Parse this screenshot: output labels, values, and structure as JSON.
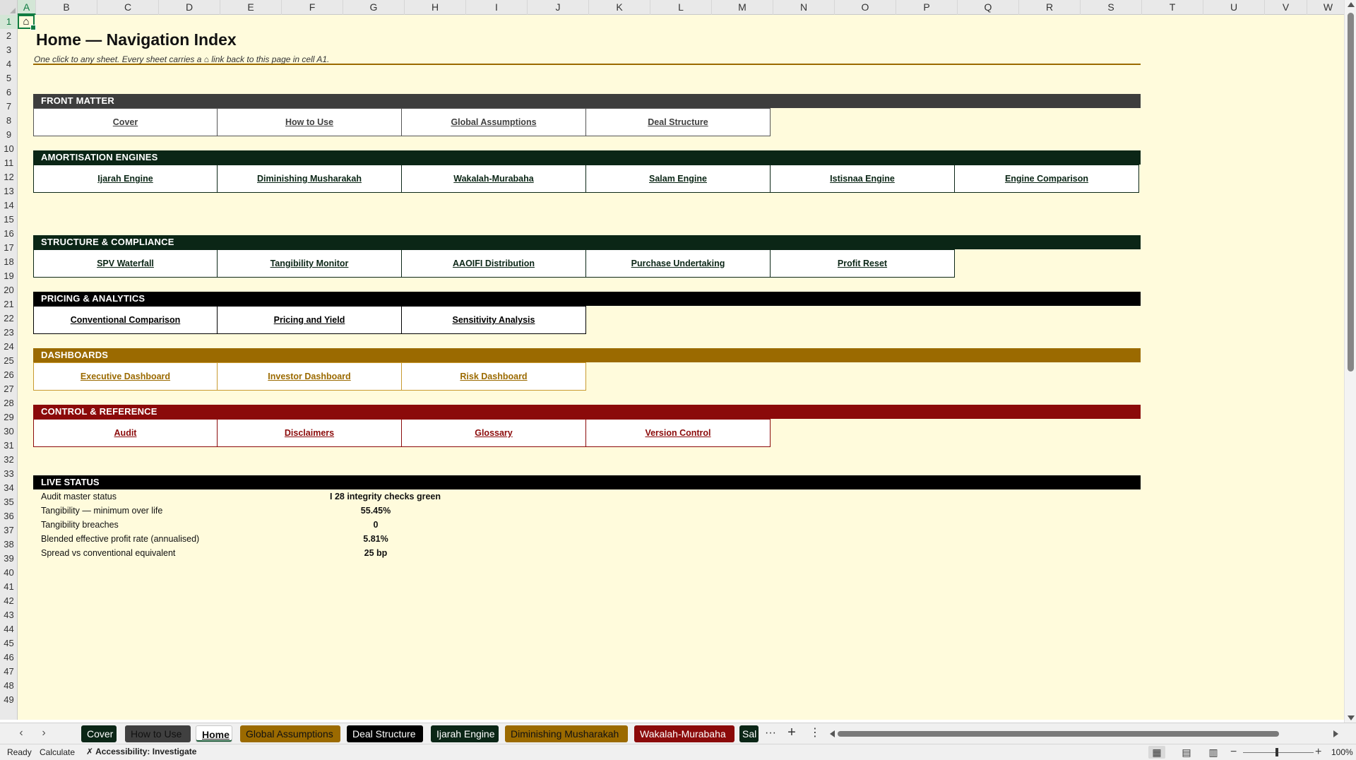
{
  "sheet": {
    "columns": [
      "A",
      "B",
      "C",
      "D",
      "E",
      "F",
      "G",
      "H",
      "I",
      "J",
      "K",
      "L",
      "M",
      "N",
      "O",
      "P",
      "Q",
      "R",
      "S",
      "T",
      "U",
      "V",
      "W"
    ],
    "rows": [
      "1",
      "2",
      "3",
      "4",
      "5",
      "6",
      "7",
      "8",
      "9",
      "10",
      "11",
      "12",
      "13",
      "14",
      "15",
      "16",
      "17",
      "18",
      "19",
      "20",
      "21",
      "22",
      "23",
      "24",
      "25",
      "26",
      "27",
      "28",
      "29",
      "30",
      "31",
      "32",
      "33",
      "34",
      "35",
      "36",
      "37",
      "38",
      "39",
      "40",
      "41",
      "42",
      "43",
      "44",
      "45",
      "46",
      "47",
      "48",
      "49"
    ],
    "active_cell": "A1",
    "home_cell_glyph": "⌂"
  },
  "page": {
    "title": "Home — Navigation Index",
    "subtitle": "One click to any sheet. Every sheet carries a ⌂ link back to this page in cell A1."
  },
  "sections": [
    {
      "name": "FRONT MATTER",
      "bar_color": "#3d3d3d",
      "link_color": "#404040",
      "border_color": "#555555",
      "links": [
        "Cover",
        "How to Use",
        "Global Assumptions",
        "Deal Structure"
      ]
    },
    {
      "name": "AMORTISATION ENGINES",
      "bar_color": "#0b2616",
      "link_color": "#0b2616",
      "border_color": "#0b2616",
      "links": [
        "Ijarah Engine",
        "Diminishing Musharakah",
        "Wakalah-Murabaha",
        "Salam Engine",
        "Istisnaa Engine",
        "Engine Comparison"
      ]
    },
    {
      "name": "STRUCTURE & COMPLIANCE",
      "bar_color": "#0b2616",
      "link_color": "#0b2616",
      "border_color": "#0b2616",
      "links": [
        "SPV Waterfall",
        "Tangibility Monitor",
        "AAOIFI Distribution",
        "Purchase Undertaking",
        "Profit Reset"
      ]
    },
    {
      "name": "PRICING & ANALYTICS",
      "bar_color": "#000000",
      "link_color": "#000000",
      "border_color": "#000000",
      "links": [
        "Conventional Comparison",
        "Pricing and Yield",
        "Sensitivity Analysis"
      ]
    },
    {
      "name": "DASHBOARDS",
      "bar_color": "#9b6a00",
      "link_color": "#9b6a00",
      "border_color": "#c89a30",
      "links": [
        "Executive Dashboard",
        "Investor Dashboard",
        "Risk Dashboard"
      ]
    },
    {
      "name": "CONTROL & REFERENCE",
      "bar_color": "#8b0a0a",
      "link_color": "#8b0a0a",
      "border_color": "#8b0a0a",
      "links": [
        "Audit",
        "Disclaimers",
        "Glossary",
        "Version Control"
      ]
    }
  ],
  "live_status": {
    "title": "LIVE STATUS",
    "rows": [
      {
        "label": "Audit master status",
        "value": "I 28 integrity checks green"
      },
      {
        "label": "Tangibility — minimum over life",
        "value": "55.45%"
      },
      {
        "label": "Tangibility breaches",
        "value": "0"
      },
      {
        "label": "Blended effective profit rate (annualised)",
        "value": "5.81%"
      },
      {
        "label": "Spread vs conventional equivalent",
        "value": "25 bp"
      }
    ]
  },
  "tabs": [
    {
      "label": "Cover",
      "bg": "#0b2616",
      "fg": "#ffffff",
      "active": false
    },
    {
      "label": "How to Use",
      "bg": "#404040",
      "fg": "#111111",
      "active": false
    },
    {
      "label": "Home",
      "bg": "#ffffff",
      "fg": "#111111",
      "active": true
    },
    {
      "label": "Global Assumptions",
      "bg": "#9b6a00",
      "fg": "#111111",
      "active": false
    },
    {
      "label": "Deal Structure",
      "bg": "#000000",
      "fg": "#ffffff",
      "active": false
    },
    {
      "label": "Ijarah Engine",
      "bg": "#0b2616",
      "fg": "#ffffff",
      "active": false
    },
    {
      "label": "Diminishing Musharakah",
      "bg": "#9b6a00",
      "fg": "#111111",
      "active": false
    },
    {
      "label": "Wakalah-Murabaha",
      "bg": "#8b0a0a",
      "fg": "#ffffff",
      "active": false
    },
    {
      "label": "Sal",
      "bg": "#0b2616",
      "fg": "#ffffff",
      "active": false
    }
  ],
  "tabbar": {
    "more": "···",
    "add": "+",
    "options": "⋮"
  },
  "statusbar": {
    "ready": "Ready",
    "calculate": "Calculate",
    "accessibility": "Accessibility: Investigate",
    "zoom": "100%"
  },
  "icons": {
    "prev_sheet": "chevron-left-icon",
    "next_sheet": "chevron-right-icon",
    "accessibility": "accessibility-icon",
    "normal_view": "grid-icon",
    "page_layout": "page-layout-icon",
    "page_break": "page-break-icon"
  },
  "theme": {
    "grid_bg": "#fffbdc",
    "accent": "#107c41",
    "title_rule": "#9b6a00"
  }
}
